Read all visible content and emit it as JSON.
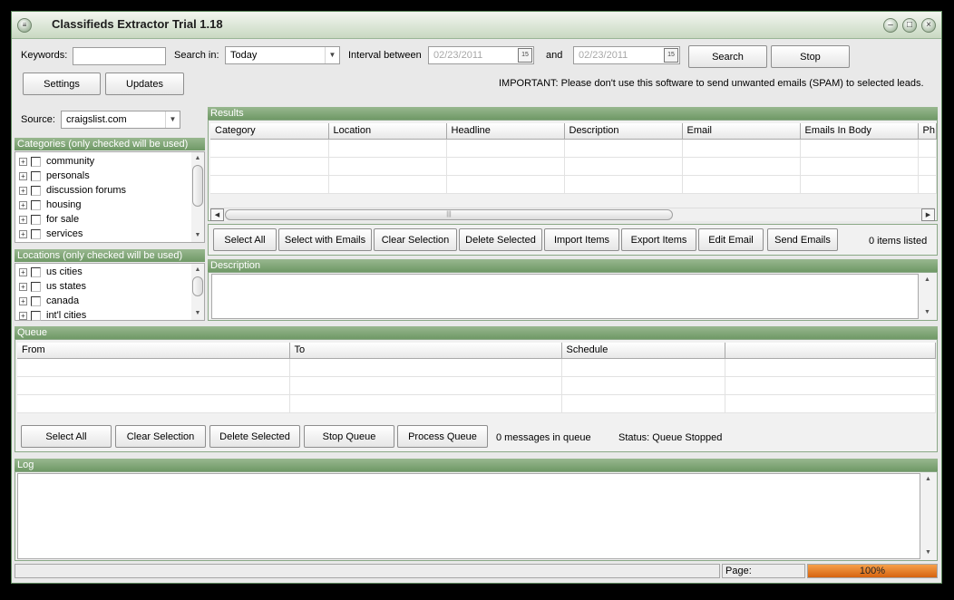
{
  "window": {
    "title": "Classifieds Extractor Trial 1.18"
  },
  "toolbar": {
    "keywords_label": "Keywords:",
    "keywords_value": "",
    "search_in_label": "Search in:",
    "search_in_value": "Today",
    "interval_label": "Interval between",
    "date_from": "02/23/2011",
    "and_label": "and",
    "date_to": "02/23/2011",
    "calendar_glyph": "15",
    "search_button": "Search",
    "stop_button": "Stop",
    "settings_button": "Settings",
    "updates_button": "Updates",
    "notice": "IMPORTANT: Please don't use this software to send unwanted emails (SPAM) to selected leads."
  },
  "source": {
    "label": "Source:",
    "value": "craigslist.com"
  },
  "categories": {
    "header": "Categories (only checked will be used)",
    "items": [
      "community",
      "personals",
      "discussion forums",
      "housing",
      "for sale",
      "services"
    ]
  },
  "locations": {
    "header": "Locations (only checked will be used)",
    "items": [
      "us cities",
      "us states",
      "canada",
      "int'l cities"
    ]
  },
  "results": {
    "header": "Results",
    "columns": [
      "Category",
      "Location",
      "Headline",
      "Description",
      "Email",
      "Emails In Body",
      "Ph"
    ],
    "buttons": {
      "select_all": "Select All",
      "select_with_emails": "Select with Emails",
      "clear_selection": "Clear Selection",
      "delete_selected": "Delete Selected",
      "import_items": "Import Items",
      "export_items": "Export Items",
      "edit_email": "Edit Email",
      "send_emails": "Send Emails"
    },
    "count": "0 items listed"
  },
  "description": {
    "header": "Description"
  },
  "queue": {
    "header": "Queue",
    "columns": [
      "From",
      "To",
      "Schedule",
      ""
    ],
    "buttons": {
      "select_all": "Select All",
      "clear_selection": "Clear Selection",
      "delete_selected": "Delete Selected",
      "stop_queue": "Stop Queue",
      "process_queue": "Process Queue"
    },
    "count": "0 messages in queue",
    "status": "Status: Queue Stopped"
  },
  "log": {
    "header": "Log"
  },
  "statusbar": {
    "page_label": "Page:",
    "progress_text": "100%",
    "progress_value": 100
  },
  "colors": {
    "accent_green": "#6f9966",
    "progress_orange": "#e0731c"
  }
}
